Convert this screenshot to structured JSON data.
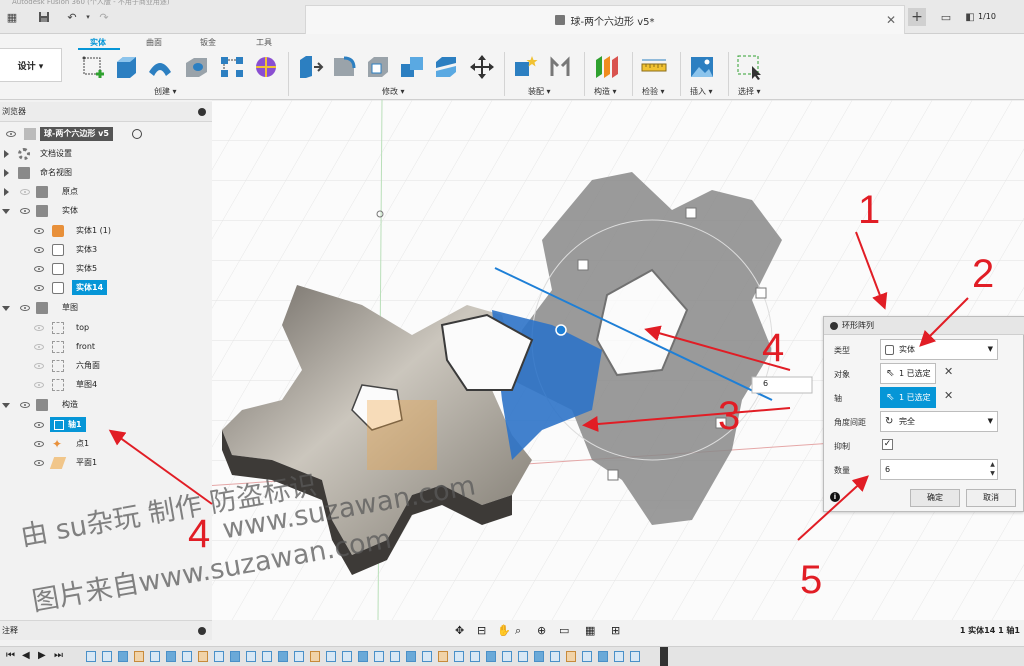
{
  "titlebar": {
    "blurred_text": "Autodesk Fusion 360 (个人版 - 不用于商业用途)",
    "document_title": "球-两个六边形 v5*",
    "job_count": "1/10"
  },
  "toolbar": {
    "workspace": "设计 ▾",
    "tabs": [
      {
        "label": "实体",
        "active": true
      },
      {
        "label": "曲面",
        "active": false
      },
      {
        "label": "钣金",
        "active": false
      },
      {
        "label": "工具",
        "active": false
      }
    ],
    "groups": {
      "create": "创建 ▾",
      "modify": "修改 ▾",
      "assemble": "装配 ▾",
      "construct": "构造 ▾",
      "inspect": "检验 ▾",
      "insert": "插入 ▾",
      "select": "选择 ▾"
    }
  },
  "browser": {
    "title": "浏览器",
    "root": "球-两个六边形 v5",
    "rows": [
      {
        "label": "文档设置"
      },
      {
        "label": "命名视图"
      },
      {
        "label": "原点"
      },
      {
        "label": "实体"
      },
      {
        "label": "实体1 (1)"
      },
      {
        "label": "实体3"
      },
      {
        "label": "实体5"
      },
      {
        "label": "实体14"
      },
      {
        "label": "草图"
      },
      {
        "label": "top"
      },
      {
        "label": "front"
      },
      {
        "label": "六角面"
      },
      {
        "label": "草图4"
      },
      {
        "label": "构造"
      },
      {
        "label": "轴1"
      },
      {
        "label": "点1"
      },
      {
        "label": "平面1"
      }
    ]
  },
  "dialog": {
    "title": "环形阵列",
    "type_label": "类型",
    "type_value": "实体",
    "objects_label": "对象",
    "objects_value": "1 已选定",
    "axis_label": "轴",
    "axis_value": "1 已选定",
    "angle_label": "角度间距",
    "angle_value": "完全",
    "suppress_label": "抑制",
    "count_label": "数量",
    "count_value": "6",
    "ok_label": "确定",
    "cancel_label": "取消"
  },
  "viewport": {
    "count_hint": "6"
  },
  "bottom": {
    "comments_label": "注释",
    "selection_info": "1 实体14 1 轴1"
  },
  "annotations": {
    "numbers": [
      "1",
      "2",
      "3",
      "4",
      "4",
      "5"
    ],
    "color": "#e11d25"
  },
  "watermark": {
    "line1": "由 su杂玩 制作 防盗标识",
    "line2": "www.suzawan.com",
    "line3": "图片来自www.suzawan.com"
  },
  "colors": {
    "accent": "#0696d7",
    "annotation_red": "#e11d25"
  }
}
